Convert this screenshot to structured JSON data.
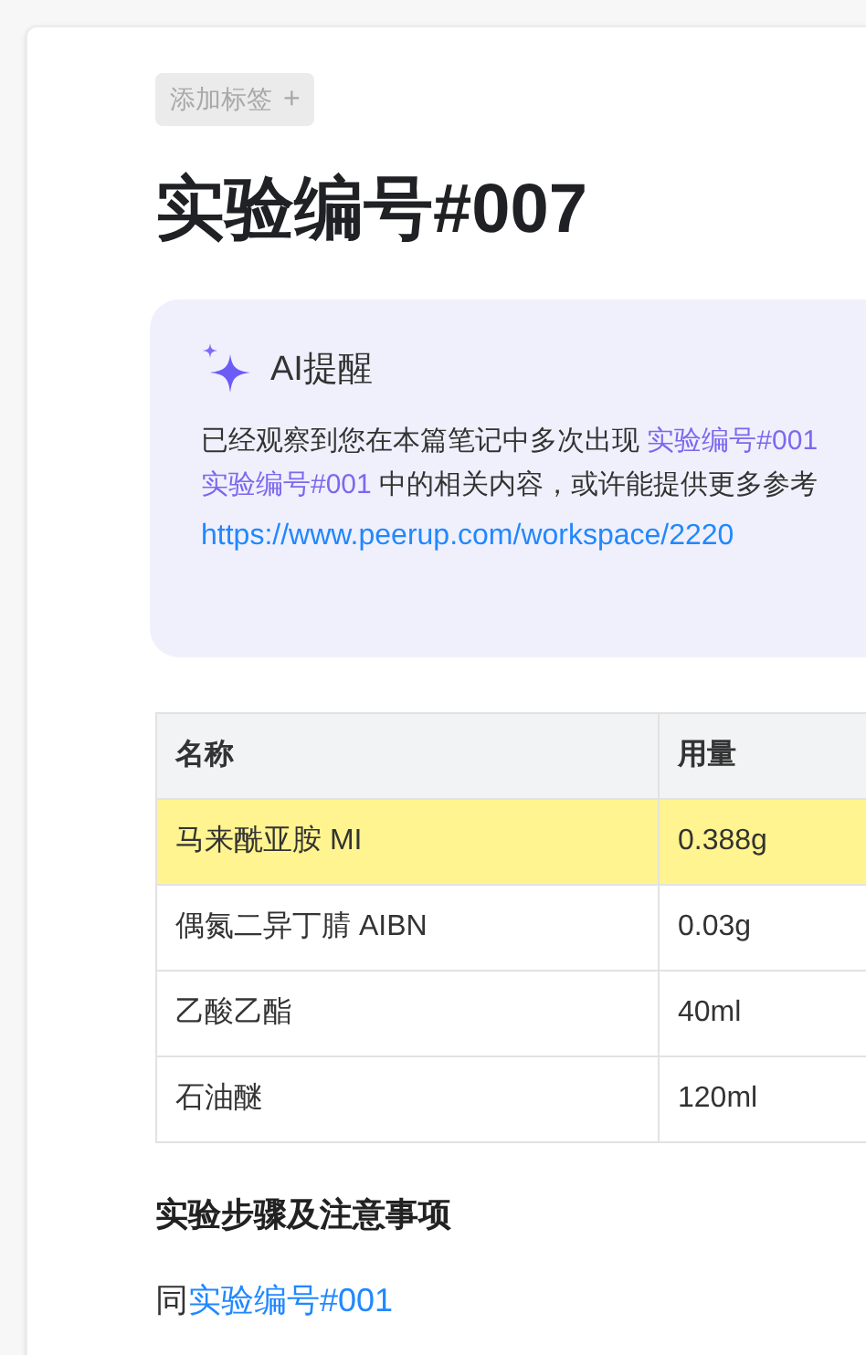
{
  "tag_button": {
    "label": "添加标签",
    "icon": "+"
  },
  "title": "实验编号#007",
  "ai_notice": {
    "title": "AI提醒",
    "lines": [
      [
        {
          "kind": "text",
          "text": "已经观察到您在本篇笔记中多次出现 "
        },
        {
          "kind": "link",
          "text": "实验编号#001"
        }
      ],
      [
        {
          "kind": "link",
          "text": "实验编号#001"
        },
        {
          "kind": "text",
          "text": " 中的相关内容，或许能提供更多参考"
        }
      ]
    ],
    "url": "https://www.peerup.com/workspace/2220"
  },
  "table": {
    "columns": [
      "名称",
      "用量"
    ],
    "rows": [
      {
        "cells": [
          "马来酰亚胺 MI",
          "0.388g"
        ],
        "highlighted": true
      },
      {
        "cells": [
          "偶氮二异丁腈 AIBN",
          "0.03g"
        ],
        "highlighted": false
      },
      {
        "cells": [
          "乙酸乙酯",
          "40ml"
        ],
        "highlighted": false
      },
      {
        "cells": [
          "石油醚",
          "120ml"
        ],
        "highlighted": false
      }
    ]
  },
  "section": {
    "heading": "实验步骤及注意事项",
    "prefix": "同",
    "link": "实验编号#001"
  }
}
